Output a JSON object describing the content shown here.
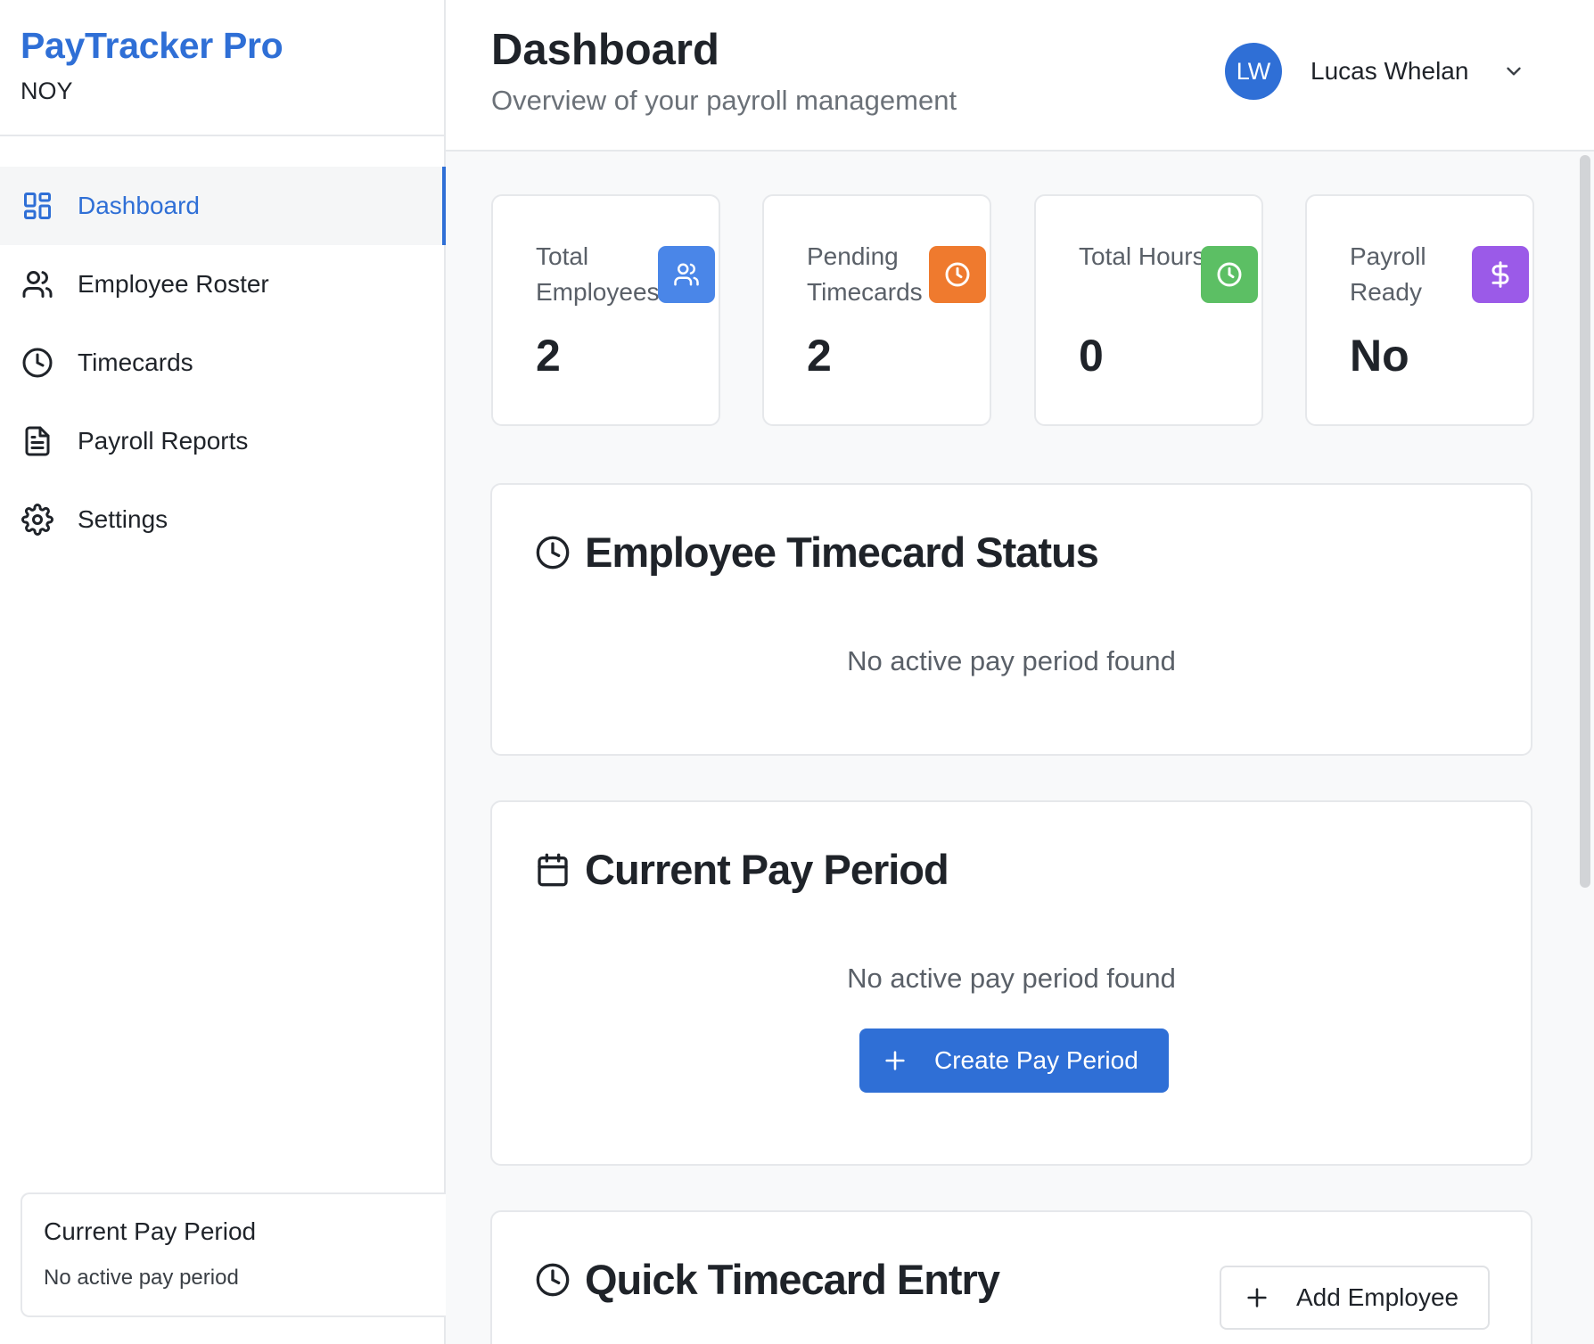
{
  "brand": {
    "title": "PayTracker Pro",
    "subtitle": "NOY"
  },
  "sidebar": {
    "items": [
      {
        "label": "Dashboard",
        "icon": "grid-icon",
        "active": true
      },
      {
        "label": "Employee Roster",
        "icon": "users-icon",
        "active": false
      },
      {
        "label": "Timecards",
        "icon": "clock-icon",
        "active": false
      },
      {
        "label": "Payroll Reports",
        "icon": "document-icon",
        "active": false
      },
      {
        "label": "Settings",
        "icon": "gear-icon",
        "active": false
      }
    ],
    "pay_period_card": {
      "title": "Current Pay Period",
      "status": "No active pay period"
    }
  },
  "header": {
    "title": "Dashboard",
    "subtitle": "Overview of your payroll management",
    "user": {
      "initials": "LW",
      "name": "Lucas Whelan"
    }
  },
  "stats": [
    {
      "label": "Total Employees",
      "value": "2",
      "icon": "users-icon",
      "color": "#4a86e8"
    },
    {
      "label": "Pending Timecards",
      "value": "2",
      "icon": "clock-icon",
      "color": "#ef7a2e"
    },
    {
      "label": "Total Hours",
      "value": "0",
      "icon": "clock-icon",
      "color": "#5cbf64"
    },
    {
      "label": "Payroll Ready",
      "value": "No",
      "icon": "dollar-icon",
      "color": "#9b5ae8"
    }
  ],
  "timecard_status": {
    "title": "Employee Timecard Status",
    "empty": "No active pay period found"
  },
  "current_pay_period": {
    "title": "Current Pay Period",
    "empty": "No active pay period found",
    "button": "Create Pay Period"
  },
  "quick_entry": {
    "title": "Quick Timecard Entry",
    "button": "Add Employee"
  },
  "colors": {
    "accent": "#2f6fd6",
    "border": "#e6e8eb",
    "background": "#f8f9fa"
  }
}
